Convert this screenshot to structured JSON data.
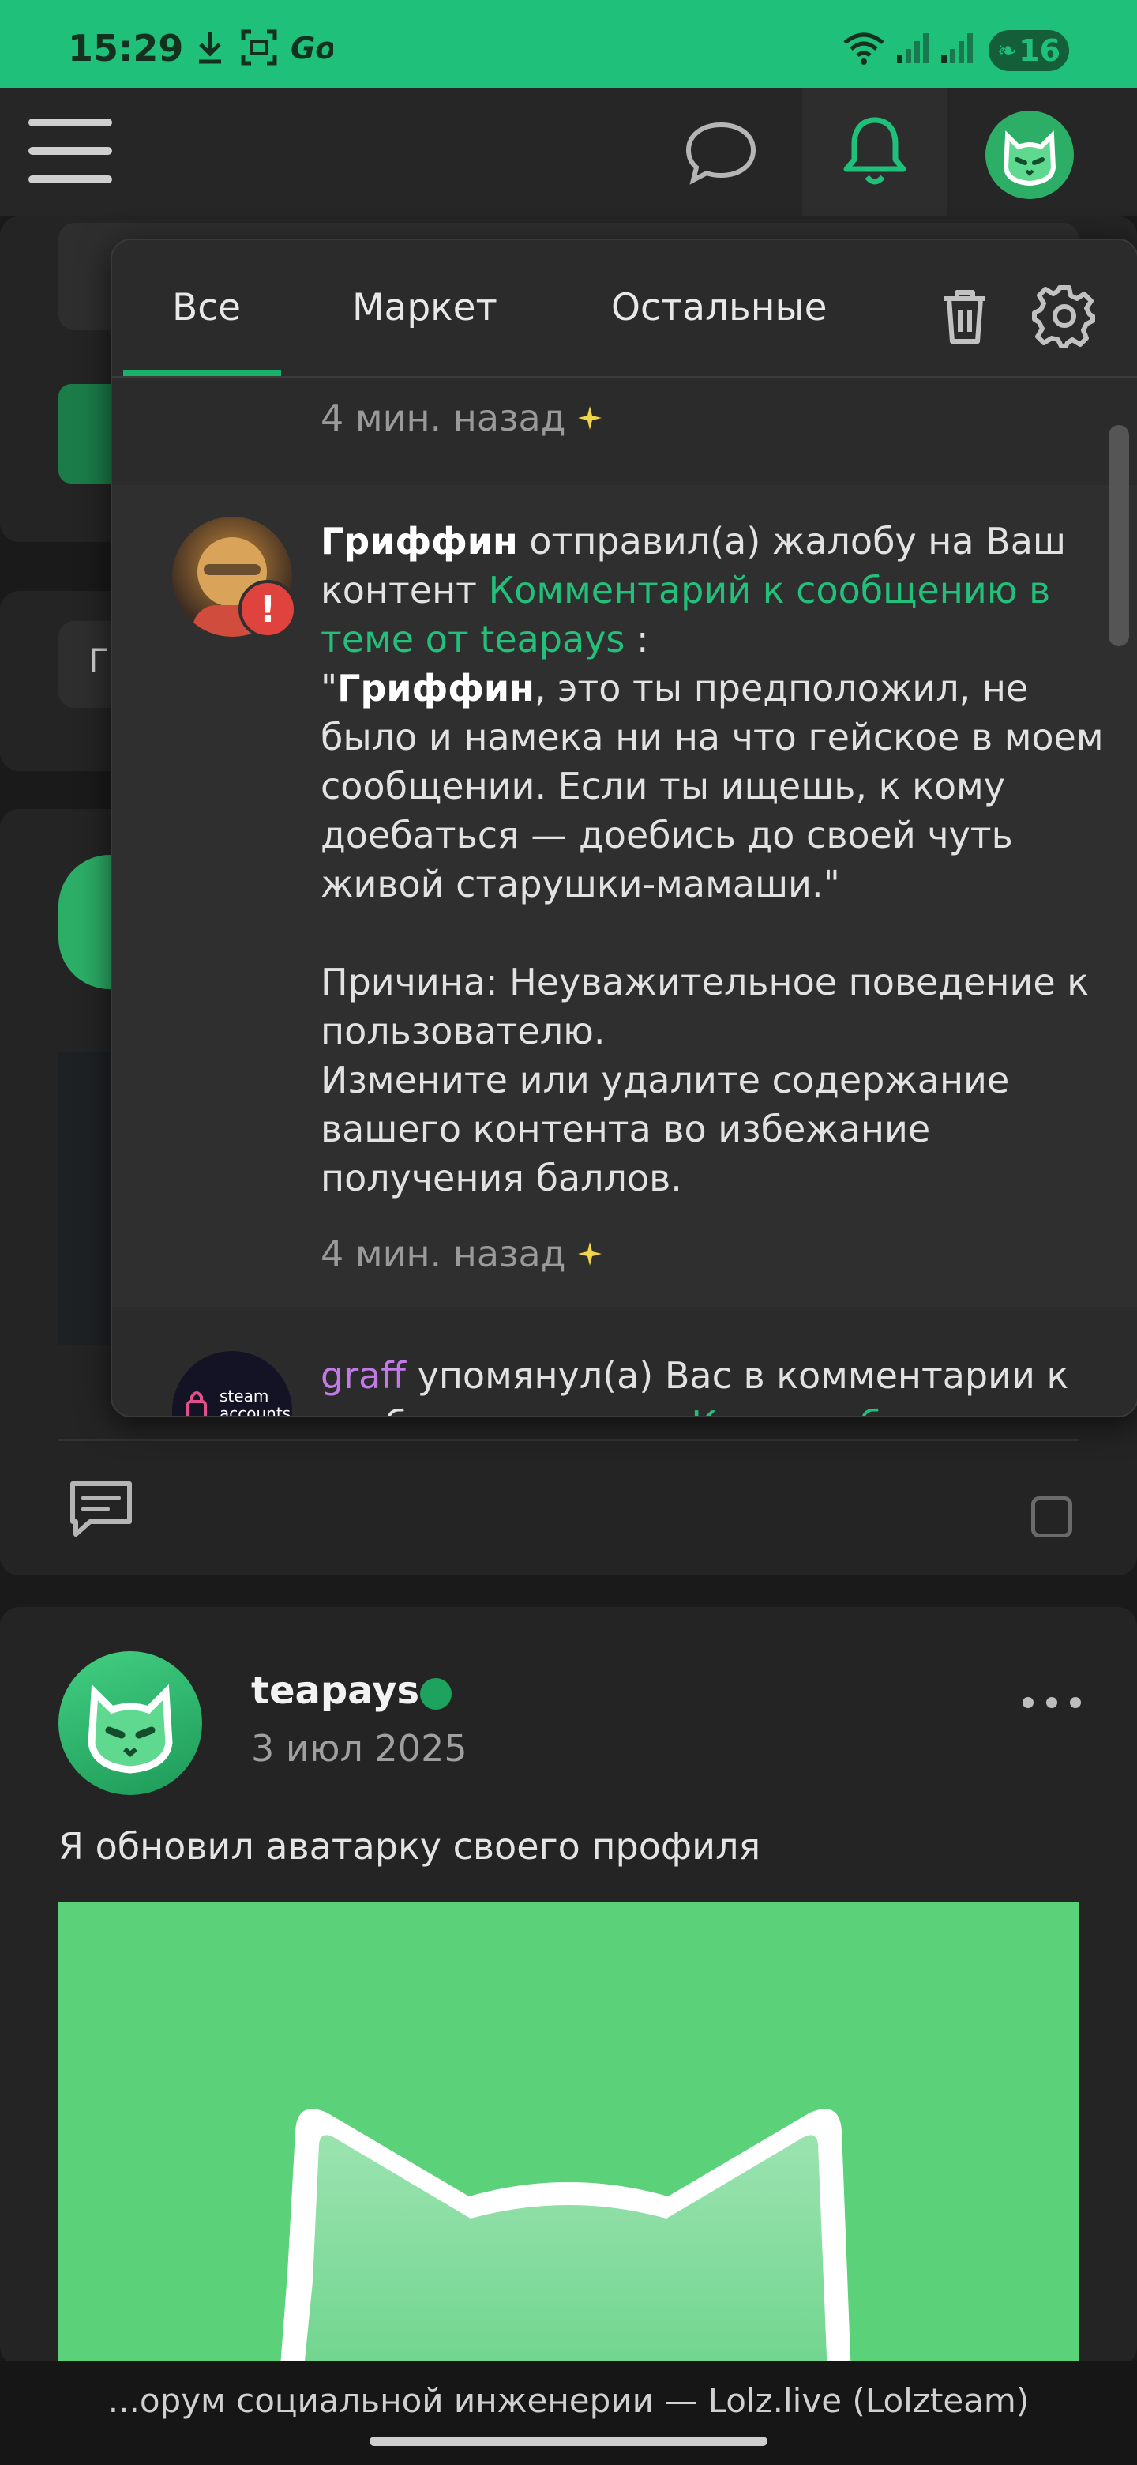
{
  "status_bar": {
    "time": "15:29",
    "battery": "16"
  },
  "nav": {
    "chat_icon": "chat-bubble-icon",
    "bell_icon": "bell-icon"
  },
  "background": {
    "partial_text": "Г"
  },
  "post": {
    "author": "teapays",
    "date": "3 июл 2025",
    "text": "Я обновил аватарку своего профиля"
  },
  "notifications": {
    "tabs": [
      "Все",
      "Маркет",
      "Остальные"
    ],
    "active_tab": "Все",
    "items": [
      {
        "time": "4 мин. назад"
      },
      {
        "user": "Гриффин",
        "action": " отправил(а) жалобу на Ваш контент ",
        "link": "Комментарий к сообщению в теме от teapays",
        "colon": " :",
        "quote_open": "\"",
        "quote_user": "Гриффин",
        "quote_text": ", это ты предположил, не было и намека ни на что гейское в моем сообщении. Если ты ищешь, к кому доебаться — доебись до своей чуть живой старушки-мамаши.\"",
        "reason": "Причина: Неуважительное поведение к пользователю.",
        "advice": "Измените или удалите содержание вашего контента во избежание получения баллов.",
        "time": "4 мин. назад"
      },
      {
        "user": "graff",
        "action": " упомянул(а) Вас в комментарии к сообщению в теме ",
        "link": "Как заработать",
        "avatar_text_1": "steam",
        "avatar_text_2": "accounts"
      }
    ]
  },
  "browser": {
    "url_title": "...орум социальной инженерии — Lolz.live (Lolzteam)"
  },
  "colors": {
    "accent": "#1ec07a",
    "link": "#22c07a",
    "mention": "#c27be6",
    "warning": "#e0433e"
  }
}
